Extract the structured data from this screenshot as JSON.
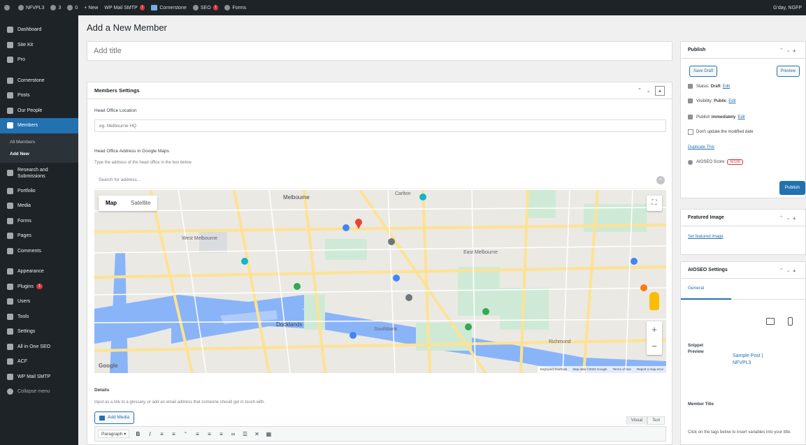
{
  "admin_bar": {
    "site_name": "NFVPL3",
    "refresh_count": "3",
    "comments_count": "0",
    "new_label": "New",
    "wp_mail_label": "WP Mail SMTP",
    "cornerstone_label": "Cornerstone",
    "seo_label": "SEO",
    "forms_label": "Forms",
    "greeting": "G'day, NGFP"
  },
  "sidebar": {
    "items": [
      {
        "label": "Dashboard"
      },
      {
        "label": "Site Kit"
      },
      {
        "label": "Pro"
      },
      {
        "label": "Cornerstone"
      },
      {
        "label": "Posts"
      },
      {
        "label": "Our People"
      },
      {
        "label": "Members"
      },
      {
        "label": "Research and Submissions"
      },
      {
        "label": "Portfolio"
      },
      {
        "label": "Media"
      },
      {
        "label": "Forms"
      },
      {
        "label": "Pages"
      },
      {
        "label": "Comments"
      },
      {
        "label": "Appearance"
      },
      {
        "label": "Plugins",
        "badge": "1"
      },
      {
        "label": "Users"
      },
      {
        "label": "Tools"
      },
      {
        "label": "Settings"
      },
      {
        "label": "All in One SEO"
      },
      {
        "label": "ACF"
      },
      {
        "label": "WP Mail SMTP"
      },
      {
        "label": "Collapse menu"
      }
    ],
    "submenu": [
      "All Members",
      "Add New"
    ]
  },
  "page": {
    "title": "Add a New Member",
    "title_placeholder": "Add title"
  },
  "members_box": {
    "title": "Members Settings",
    "head_office_label": "Head Office Location",
    "head_office_placeholder": "eg. Melbourne HQ",
    "address_label": "Head Office Address in Google Maps",
    "address_desc": "Type the address of the head office in the box below.",
    "search_placeholder": "Search for address...",
    "map": {
      "tab_map": "Map",
      "tab_satellite": "Satellite",
      "labels": [
        "Melbourne",
        "West Melbourne",
        "East Melbourne",
        "Docklands",
        "Richmond",
        "Southbank",
        "Carlton"
      ],
      "logo": "Google",
      "footer": [
        "Keyboard shortcuts",
        "Map data ©2022 Google",
        "Terms of Use",
        "Report a map error"
      ]
    },
    "details_label": "Details",
    "details_desc": "Input as a link to a glossary, or add an email address that someone should get in touch with.",
    "add_media": "Add Media",
    "tab_visual": "Visual",
    "tab_text": "Text",
    "format_select": "Paragraph"
  },
  "publish": {
    "title": "Publish",
    "save_draft": "Save Draft",
    "preview": "Preview",
    "status_label": "Status:",
    "status_value": "Draft",
    "visibility_label": "Visibility:",
    "visibility_value": "Public",
    "publish_label": "Publish",
    "publish_value": "immediately",
    "edit": "Edit",
    "dont_update": "Don't update the modified date",
    "duplicate": "Duplicate This",
    "aioseo_label": "AIOSEO Score",
    "aioseo_value": "N/100",
    "publish_button": "Publish"
  },
  "featured_image": {
    "title": "Featured Image",
    "link": "Set featured image"
  },
  "aioseo": {
    "title": "AIOSEO Settings",
    "tab_general": "General",
    "snippet_label": "Snippet Preview",
    "snippet_title": "Sample Post | NFVPL3",
    "member_title_label": "Member Title",
    "member_title_desc": "Click on the tags below to insert variables into your title."
  }
}
